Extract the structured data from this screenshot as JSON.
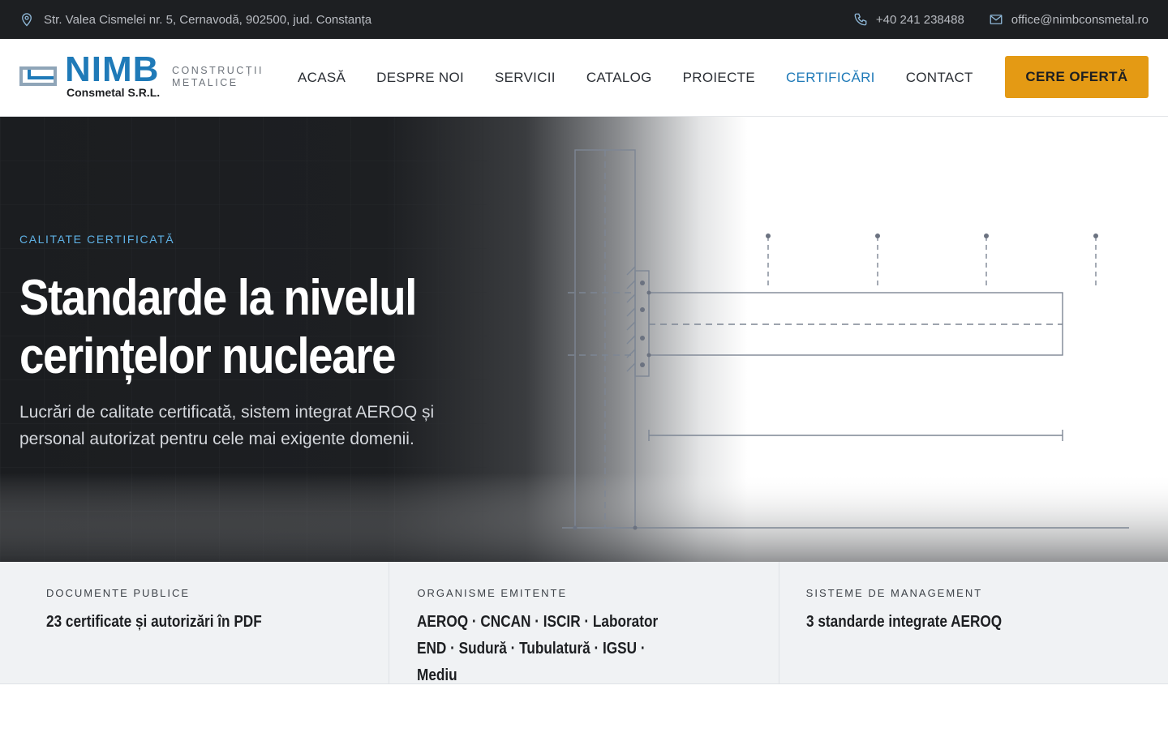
{
  "topbar": {
    "address": "Str. Valea Cismelei nr. 5, Cernavodă, 902500, jud. Constanța",
    "phone": "+40 241 238488",
    "email": "office@nimbconsmetal.ro",
    "icons": [
      "map-pin-icon",
      "phone-icon",
      "mail-icon"
    ]
  },
  "brand": {
    "name": "NIMB",
    "company": "Consmetal S.R.L.",
    "tagline_1": "CONSTRUCȚII",
    "tagline_2": "METALICE",
    "color": "#1f7ab8"
  },
  "nav": {
    "items": [
      {
        "label": "ACASĂ"
      },
      {
        "label": "DESPRE NOI"
      },
      {
        "label": "SERVICII"
      },
      {
        "label": "CATALOG"
      },
      {
        "label": "PROIECTE"
      },
      {
        "label": "CERTIFICĂRI",
        "active": true
      },
      {
        "label": "CONTACT"
      }
    ],
    "cta": "CERE OFERTĂ",
    "cta_color": "#e49a14"
  },
  "hero": {
    "eyebrow": "CALITATE CERTIFICATĂ",
    "title": "Standarde la nivelul cerințelor nucleare",
    "lead": "Lucrări de calitate certificată, sistem integrat AEROQ și personal autorizat pentru cele mai exigente domenii."
  },
  "strip": [
    {
      "label": "DOCUMENTE PUBLICE",
      "value": "23 certificate și autorizări în PDF"
    },
    {
      "label": "ORGANISME EMITENTE",
      "value": "AEROQ · CNCAN · ISCIR · Laborator END · Sudură · Tubulatură · IGSU · Mediu"
    },
    {
      "label": "SISTEME DE MANAGEMENT",
      "value": "3 standarde integrate AEROQ"
    }
  ]
}
